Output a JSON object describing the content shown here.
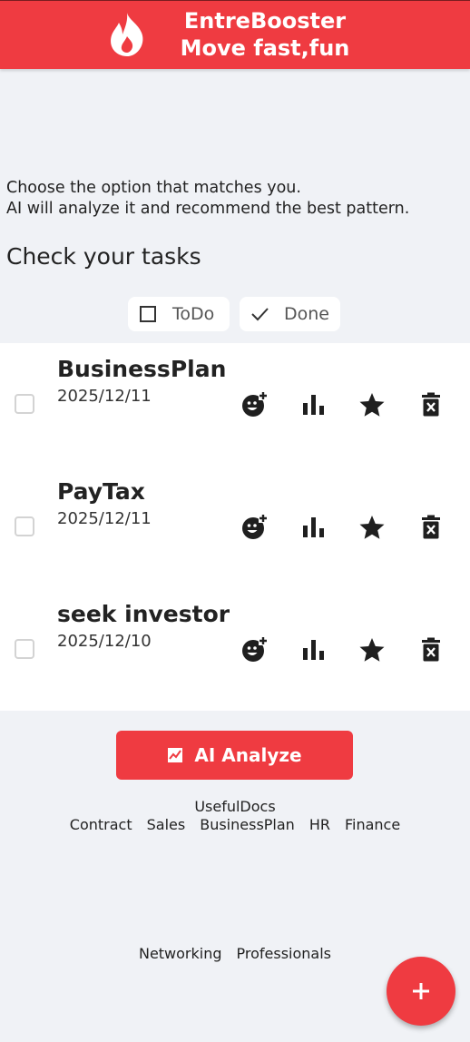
{
  "header": {
    "logo_icon": "flame-icon",
    "title_line1": "EntreBooster",
    "title_line2": "Move fast,fun",
    "bg_color": "#ef3b41"
  },
  "intro": {
    "line1": "Choose the option that matches you.",
    "line2": "AI will analyze it and recommend the best pattern."
  },
  "section_title": "Check your tasks",
  "filters": [
    {
      "label": "ToDo",
      "icon": "checkbox-outline-icon"
    },
    {
      "label": "Done",
      "icon": "check-icon"
    }
  ],
  "tasks": [
    {
      "name": "BusinessPlan",
      "date": "2025/12/11"
    },
    {
      "name": "PayTax",
      "date": "2025/12/11"
    },
    {
      "name": "seek investor",
      "date": "2025/12/10"
    }
  ],
  "task_actions": [
    "add-reaction-icon",
    "bar-chart-icon",
    "star-icon",
    "delete-icon"
  ],
  "ai_button": {
    "label": "AI Analyze",
    "icon": "chart-icon"
  },
  "useful_docs": {
    "title": "UsefulDocs",
    "items": [
      "Contract",
      "Sales",
      "BusinessPlan",
      "HR",
      "Finance"
    ]
  },
  "links": [
    "Networking",
    "Professionals"
  ],
  "fab": {
    "icon": "plus-icon"
  }
}
